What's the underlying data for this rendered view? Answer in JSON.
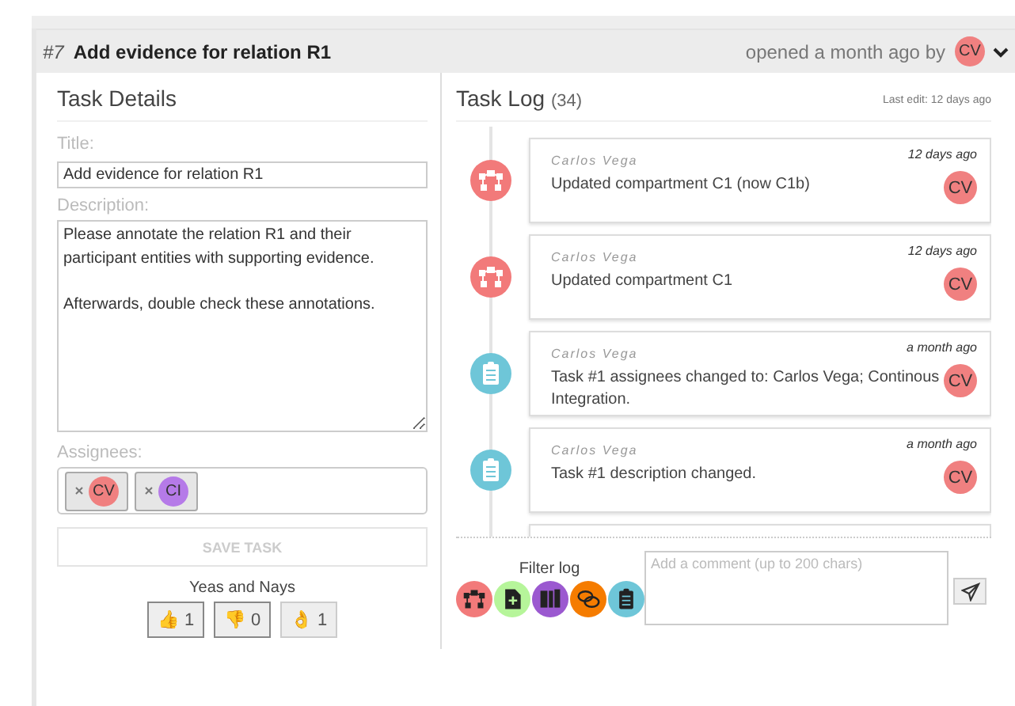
{
  "header": {
    "number": "#7",
    "title": "Add evidence for relation R1",
    "opened": "opened a month ago by",
    "avatar": "CV"
  },
  "details": {
    "heading": "Task Details",
    "title_label": "Title:",
    "title_value": "Add evidence for relation R1",
    "description_label": "Description:",
    "description_value": "Please annotate the relation R1 and their participant entities with supporting evidence.\n\nAfterwards, double check these annotations.",
    "assignees_label": "Assignees:",
    "assignees": [
      {
        "initials": "CV",
        "color": "#f08080"
      },
      {
        "initials": "CI",
        "color": "#b57ae8"
      }
    ],
    "save_button": {
      "label": "SAVE TASK",
      "disabled": true
    },
    "reactions_label": "Yeas and Nays",
    "reactions": [
      {
        "emoji": "👍",
        "count": "1",
        "selected": true
      },
      {
        "emoji": "👎",
        "count": "0",
        "selected": true
      },
      {
        "emoji": "👌",
        "count": "1",
        "selected": false
      }
    ]
  },
  "log": {
    "heading": "Task Log",
    "count": "(34)",
    "last_edit": "Last edit: 12 days ago",
    "entries": [
      {
        "kind": "compartment",
        "author": "Carlos Vega",
        "time": "12 days ago",
        "text": "Updated compartment C1 (now C1b)",
        "avatar": "CV"
      },
      {
        "kind": "compartment",
        "author": "Carlos Vega",
        "time": "12 days ago",
        "text": "Updated compartment C1",
        "avatar": "CV"
      },
      {
        "kind": "task",
        "author": "Carlos Vega",
        "time": "a month ago",
        "text": "Task #1 assignees changed to: Carlos Vega; Continous Integration.",
        "avatar": "CV"
      },
      {
        "kind": "task",
        "author": "Carlos Vega",
        "time": "a month ago",
        "text": "Task #1 description changed.",
        "avatar": "CV"
      }
    ],
    "filter_label": "Filter log",
    "filters": [
      {
        "kind": "compartment"
      },
      {
        "kind": "document"
      },
      {
        "kind": "evidence"
      },
      {
        "kind": "comment"
      },
      {
        "kind": "task"
      }
    ],
    "comment_placeholder": "Add a comment (up to 200 chars)"
  }
}
